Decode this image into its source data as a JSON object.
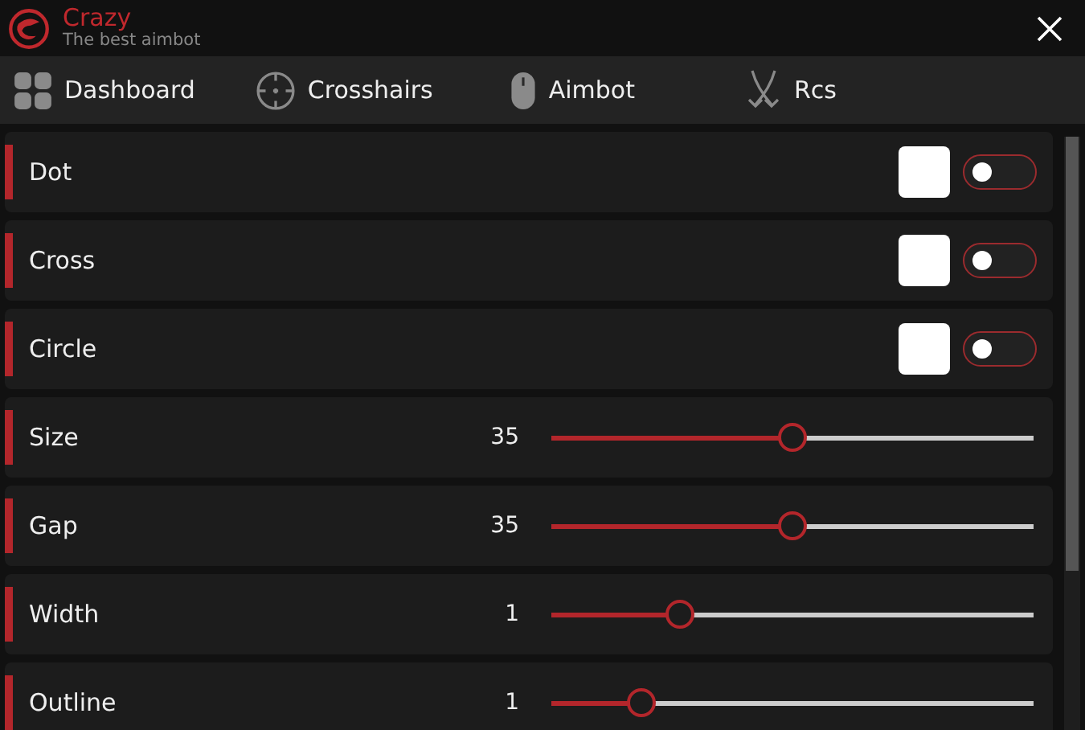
{
  "window": {
    "title": "Crazy",
    "subtitle": "The best aimbot"
  },
  "nav": [
    {
      "label": "Dashboard",
      "kind": "grid"
    },
    {
      "label": "Crosshairs",
      "kind": "crosshair"
    },
    {
      "label": "Aimbot",
      "kind": "mouse"
    },
    {
      "label": "Rcs",
      "kind": "arrows"
    }
  ],
  "settings": [
    {
      "kind": "toggle",
      "label": "Dot",
      "color": "#ffffff",
      "on": false
    },
    {
      "kind": "toggle",
      "label": "Cross",
      "color": "#ffffff",
      "on": false
    },
    {
      "kind": "toggle",
      "label": "Circle",
      "color": "#ffffff",
      "on": false
    },
    {
      "kind": "slider",
      "label": "Size",
      "reading": "35",
      "level": 0.5
    },
    {
      "kind": "slider",
      "label": "Gap",
      "reading": "35",
      "level": 0.5
    },
    {
      "kind": "slider",
      "label": "Width",
      "reading": "1",
      "level": 0.265
    },
    {
      "kind": "slider",
      "label": "Outline",
      "reading": "1",
      "level": 0.188
    }
  ]
}
